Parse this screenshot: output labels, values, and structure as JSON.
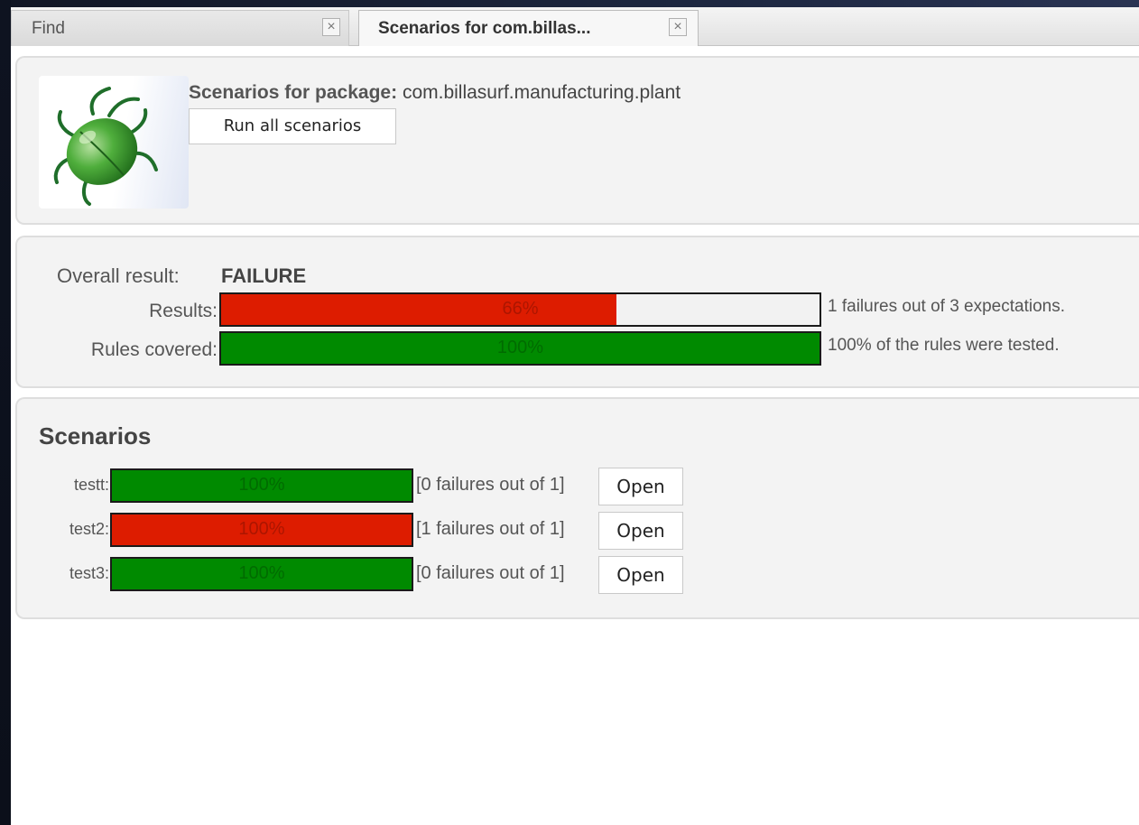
{
  "tabs": [
    {
      "label": "Find",
      "close_glyph": "×",
      "active": false
    },
    {
      "label": "Scenarios for com.billas...",
      "close_glyph": "×",
      "active": true
    }
  ],
  "header": {
    "package_label": "Scenarios for package:",
    "package_name": "com.billasurf.manufacturing.plant",
    "run_all_label": "Run all scenarios",
    "icon": "green-bug-icon"
  },
  "summary": {
    "overall_label": "Overall result:",
    "overall_value": "FAILURE",
    "results": {
      "label": "Results:",
      "percent_text": "66%",
      "fill": 0.66,
      "color": "#dd1c00",
      "note": "1 failures out of 3 expectations."
    },
    "rules": {
      "label": "Rules covered:",
      "percent_text": "100%",
      "fill": 1.0,
      "color": "#008a00",
      "note": "100% of the rules were tested."
    }
  },
  "scenarios": {
    "title": "Scenarios",
    "open_label": "Open",
    "rows": [
      {
        "name": "testt:",
        "percent_text": "100%",
        "fill": 1.0,
        "color": "#008a00",
        "note": "[0 failures out of 1]"
      },
      {
        "name": "test2:",
        "percent_text": "100%",
        "fill": 1.0,
        "color": "#dd1c00",
        "note": "[1 failures out of 1]"
      },
      {
        "name": "test3:",
        "percent_text": "100%",
        "fill": 1.0,
        "color": "#008a00",
        "note": "[0 failures out of 1]"
      }
    ]
  }
}
